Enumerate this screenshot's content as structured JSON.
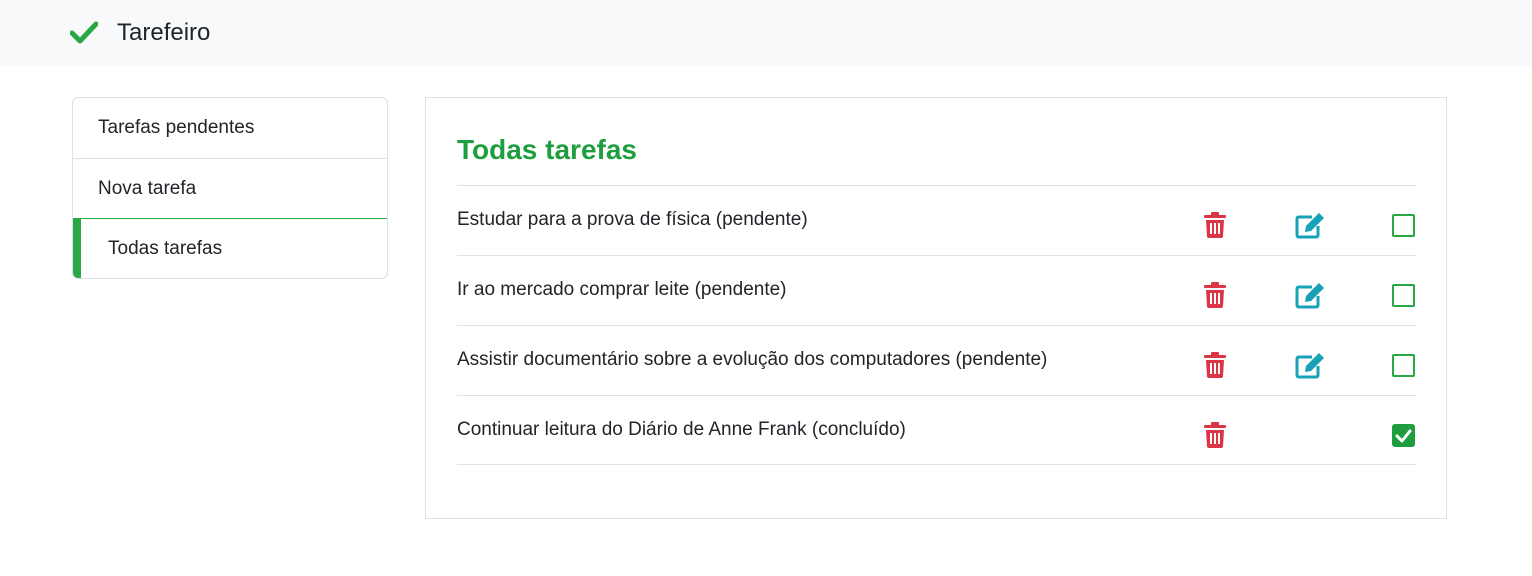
{
  "app": {
    "title": "Tarefeiro",
    "brand_icon": "check-icon"
  },
  "colors": {
    "accent": "#1e9e3e",
    "danger": "#dc3545",
    "info": "#17a2b8",
    "border": "#dee2e6"
  },
  "sidebar": {
    "items": [
      {
        "label": "Tarefas pendentes",
        "active": false
      },
      {
        "label": "Nova tarefa",
        "active": false
      },
      {
        "label": "Todas tarefas",
        "active": true
      }
    ]
  },
  "main": {
    "title": "Todas tarefas",
    "tasks": [
      {
        "text": "Estudar para a prova de física (pendente)",
        "done": false,
        "editable": true
      },
      {
        "text": "Ir ao mercado comprar leite (pendente)",
        "done": false,
        "editable": true
      },
      {
        "text": "Assistir documentário sobre a evolução dos computadores (pendente)",
        "done": false,
        "editable": true
      },
      {
        "text": "Continuar leitura do Diário de Anne Frank (concluído)",
        "done": true,
        "editable": false
      }
    ]
  }
}
